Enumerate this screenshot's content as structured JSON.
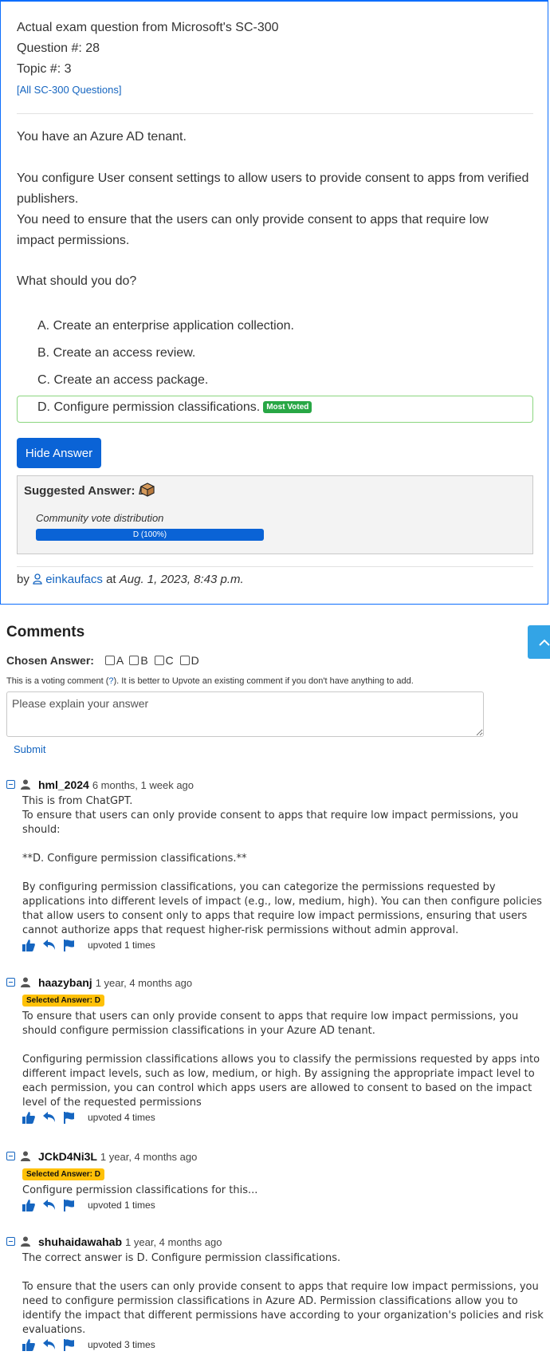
{
  "question": {
    "source": "Actual exam question from Microsoft's SC-300",
    "number": "Question #: 28",
    "topic": "Topic #: 3",
    "all_link": "[All SC-300 Questions]",
    "p1": "You have an Azure AD tenant.",
    "p2": "You configure User consent settings to allow users to provide consent to apps from verified publishers.",
    "p3": "You need to ensure that the users can only provide consent to apps that require low impact permissions.",
    "p4": "What should you do?",
    "options": [
      "A. Create an enterprise application collection.",
      "B. Create an access review.",
      "C. Create an access package.",
      "D. Configure permission classifications."
    ],
    "most_voted": "Most Voted",
    "hide_answer": "Hide Answer",
    "suggested_label": "Suggested Answer:",
    "suggested_value": "D",
    "vote_dist_label": "Community vote distribution",
    "vote_bar_label": "D (100%)",
    "vote_fraction": 1.0,
    "by": "by",
    "author": "einkaufacs",
    "at": "at",
    "date": "Aug. 1, 2023, 8:43 p.m."
  },
  "comments_section": {
    "title": "Comments",
    "chosen_label": "Chosen Answer:",
    "choices": [
      "A",
      "B",
      "C",
      "D"
    ],
    "note_before": "This is a voting comment (",
    "note_link": "?",
    "note_after": "). It is better to Upvote an existing comment if you don't have anything to add.",
    "placeholder": "Please explain your answer",
    "submit": "Submit"
  },
  "comments": [
    {
      "user": "hml_2024",
      "when": "6 months, 1 week ago",
      "badge": "",
      "body": "This is from ChatGPT.\nTo ensure that users can only provide consent to apps that require low impact permissions, you should:\n\n**D. Configure permission classifications.**\n\nBy configuring permission classifications, you can categorize the permissions requested by applications into different levels of impact (e.g., low, medium, high). You can then configure policies that allow users to consent only to apps that require low impact permissions, ensuring that users cannot authorize apps that request higher-risk permissions without admin approval.",
      "votes": "upvoted 1 times"
    },
    {
      "user": "haazybanj",
      "when": "1 year, 4 months ago",
      "badge": "Selected Answer: D",
      "body": "To ensure that users can only provide consent to apps that require low impact permissions, you should configure permission classifications in your Azure AD tenant.\n\nConfiguring permission classifications allows you to classify the permissions requested by apps into different impact levels, such as low, medium, or high. By assigning the appropriate impact level to each permission, you can control which apps users are allowed to consent to based on the impact level of the requested permissions",
      "votes": "upvoted 4 times"
    },
    {
      "user": "JCkD4Ni3L",
      "when": "1 year, 4 months ago",
      "badge": "Selected Answer: D",
      "body": "Configure permission classifications for this...",
      "votes": "upvoted 1 times"
    },
    {
      "user": "shuhaidawahab",
      "when": "1 year, 4 months ago",
      "badge": "",
      "body": "The correct answer is D. Configure permission classifications.\n\nTo ensure that the users can only provide consent to apps that require low impact permissions, you need to configure permission classifications in Azure AD. Permission classifications allow you to identify the impact that different permissions have according to your organization's policies and risk evaluations.",
      "votes": "upvoted 3 times"
    }
  ],
  "colors": {
    "accent": "#0a63d6",
    "link": "#1565c0",
    "most_voted": "#28a745",
    "selected_badge": "#ffc107"
  }
}
